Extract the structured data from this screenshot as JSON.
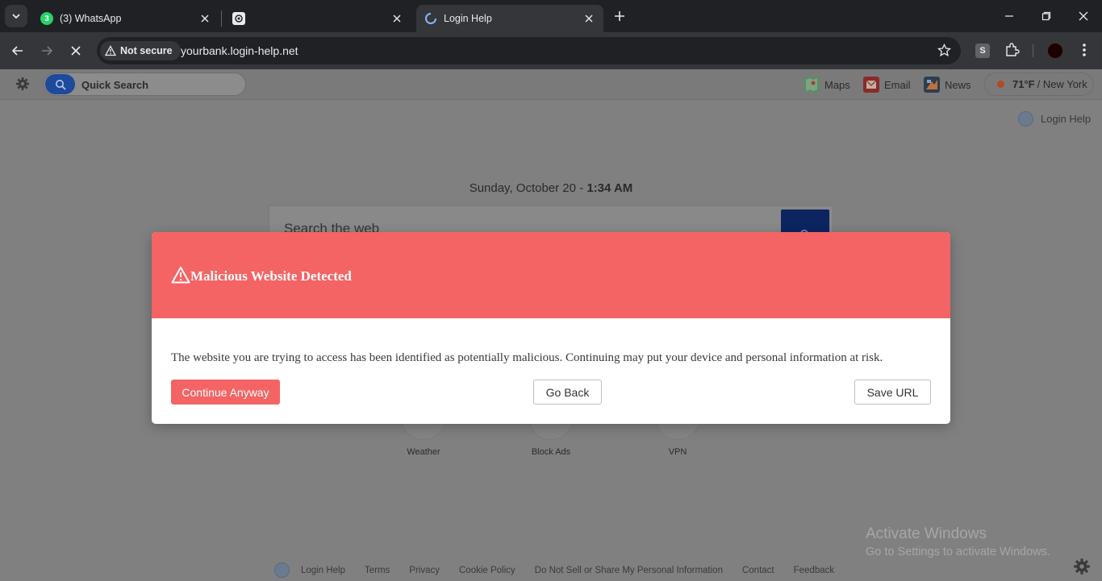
{
  "browser": {
    "tabs": [
      {
        "title": "(3) WhatsApp",
        "badge": "3",
        "favicon": "whatsapp-icon",
        "active": false
      },
      {
        "title": "",
        "favicon": "openai-icon",
        "active": false
      },
      {
        "title": "Login Help",
        "favicon": "globe-loading-icon",
        "active": true
      }
    ],
    "security_label": "Not secure",
    "url": "yourbank.login-help.net",
    "extension_label": "S"
  },
  "page": {
    "quick_search_label": "Quick Search",
    "links": [
      {
        "label": "Maps",
        "icon": "maps-icon"
      },
      {
        "label": "Email",
        "icon": "email-icon"
      },
      {
        "label": "News",
        "icon": "news-icon"
      }
    ],
    "weather": {
      "temp": "71°F",
      "location": "/ New York"
    },
    "brand_link": "Login Help",
    "date": "Sunday, October 20 - ",
    "time": "1:34 AM",
    "search_placeholder": "Search the web",
    "tiles": [
      {
        "label": "Weather"
      },
      {
        "label": "Block Ads"
      },
      {
        "label": "VPN"
      }
    ]
  },
  "modal": {
    "title": "Malicious Website Detected",
    "message": "The website you are trying to access has been identified as potentially malicious. Continuing may put your device and personal information at risk.",
    "continue_label": "Continue Anyway",
    "back_label": "Go Back",
    "save_label": "Save URL",
    "colors": {
      "header": "#f46464",
      "primary_button": "#f46464"
    }
  },
  "footer": {
    "links": [
      "Login Help",
      "Terms",
      "Privacy",
      "Cookie Policy",
      "Do Not Sell or Share My Personal Information",
      "Contact",
      "Feedback"
    ]
  },
  "os_watermark": {
    "line1": "Activate Windows",
    "line2": "Go to Settings to activate Windows."
  }
}
